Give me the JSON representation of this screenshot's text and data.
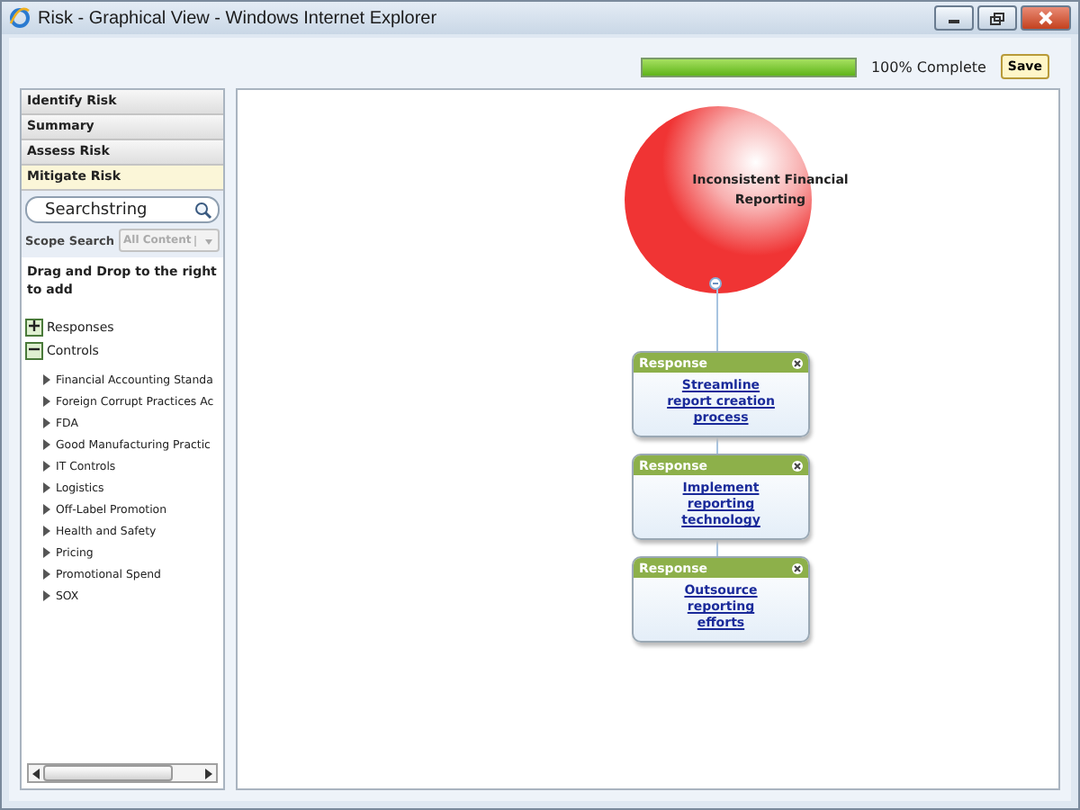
{
  "window": {
    "title": "Risk - Graphical View - Windows Internet Explorer"
  },
  "progress": {
    "level": 1,
    "reading": "100% Complete"
  },
  "save_button": "Save",
  "steps": [
    {
      "label": "Identify Risk",
      "selected": false
    },
    {
      "label": "Summary",
      "selected": false
    },
    {
      "label": "Assess Risk",
      "selected": false
    },
    {
      "label": "Mitigate Risk",
      "selected": true
    }
  ],
  "search": {
    "value": "Searchstring"
  },
  "scope": {
    "label": "Scope Search",
    "value": "All Content",
    "disabled": true
  },
  "instructions": "Drag and Drop to the right to add",
  "tree": [
    {
      "label": "Responses",
      "expanded": false
    },
    {
      "label": "Controls",
      "expanded": true,
      "children": [
        {
          "label": "Financial Accounting Standa"
        },
        {
          "label": "Foreign Corrupt Practices Ac"
        },
        {
          "label": "FDA"
        },
        {
          "label": "Good Manufacturing Practic"
        },
        {
          "label": "IT Controls"
        },
        {
          "label": "Logistics"
        },
        {
          "label": "Off-Label Promotion"
        },
        {
          "label": "Health and Safety"
        },
        {
          "label": "Pricing"
        },
        {
          "label": "Promotional Spend"
        },
        {
          "label": "SOX"
        }
      ]
    }
  ],
  "risk": {
    "label": "Inconsistent Financial Reporting"
  },
  "responses": [
    {
      "header": "Response",
      "link": "Streamline report creation process"
    },
    {
      "header": "Response",
      "link": "Implement reporting technology"
    },
    {
      "header": "Response",
      "link": "Outsource reporting efforts"
    }
  ]
}
